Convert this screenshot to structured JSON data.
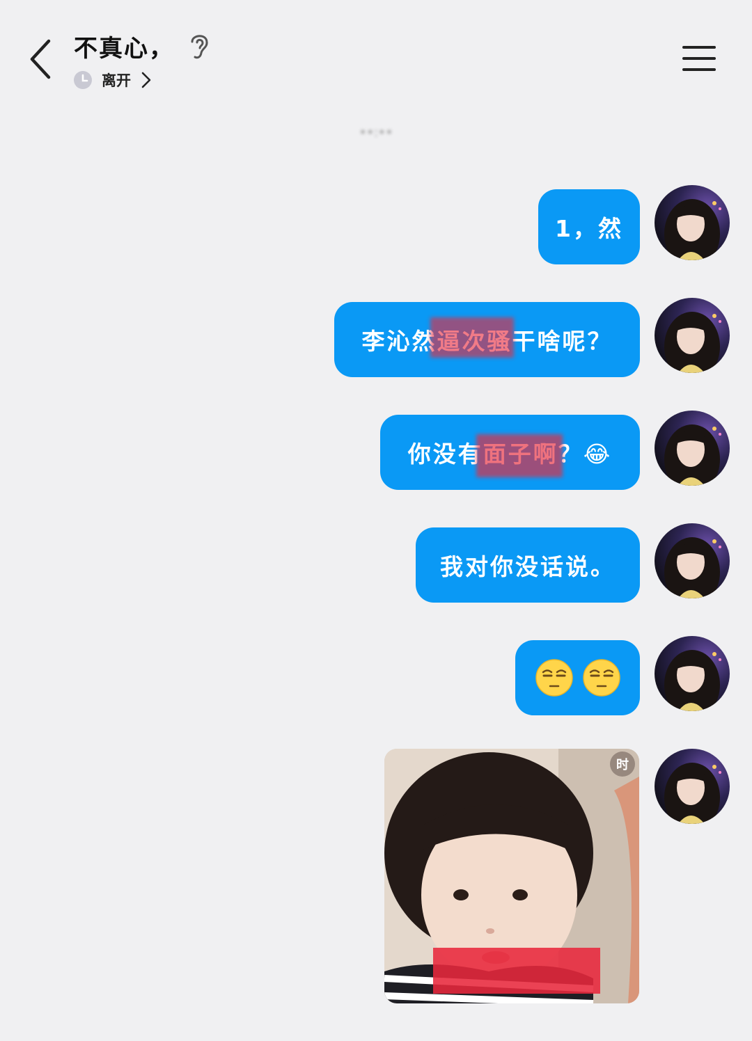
{
  "header": {
    "contact_name": "不真心，",
    "status": "离开"
  },
  "conversation": {
    "timestamp": "••:••",
    "messages": [
      {
        "type": "text",
        "text": "1，然"
      },
      {
        "type": "text",
        "text": "李沁然逼次骚干啥呢？",
        "parts": [
          "李沁然逼次骚干啥呢？"
        ]
      },
      {
        "type": "text",
        "text": "你没有面子啊？😂"
      },
      {
        "type": "text",
        "text": "我对你没话说。"
      },
      {
        "type": "emoji",
        "icons": [
          "unamused-face-icon",
          "unamused-face-icon"
        ]
      },
      {
        "type": "image",
        "badge": "时"
      }
    ]
  },
  "colors": {
    "bubble": "#0a99f5",
    "background": "#f0f0f2",
    "redaction": "#e8283c"
  }
}
